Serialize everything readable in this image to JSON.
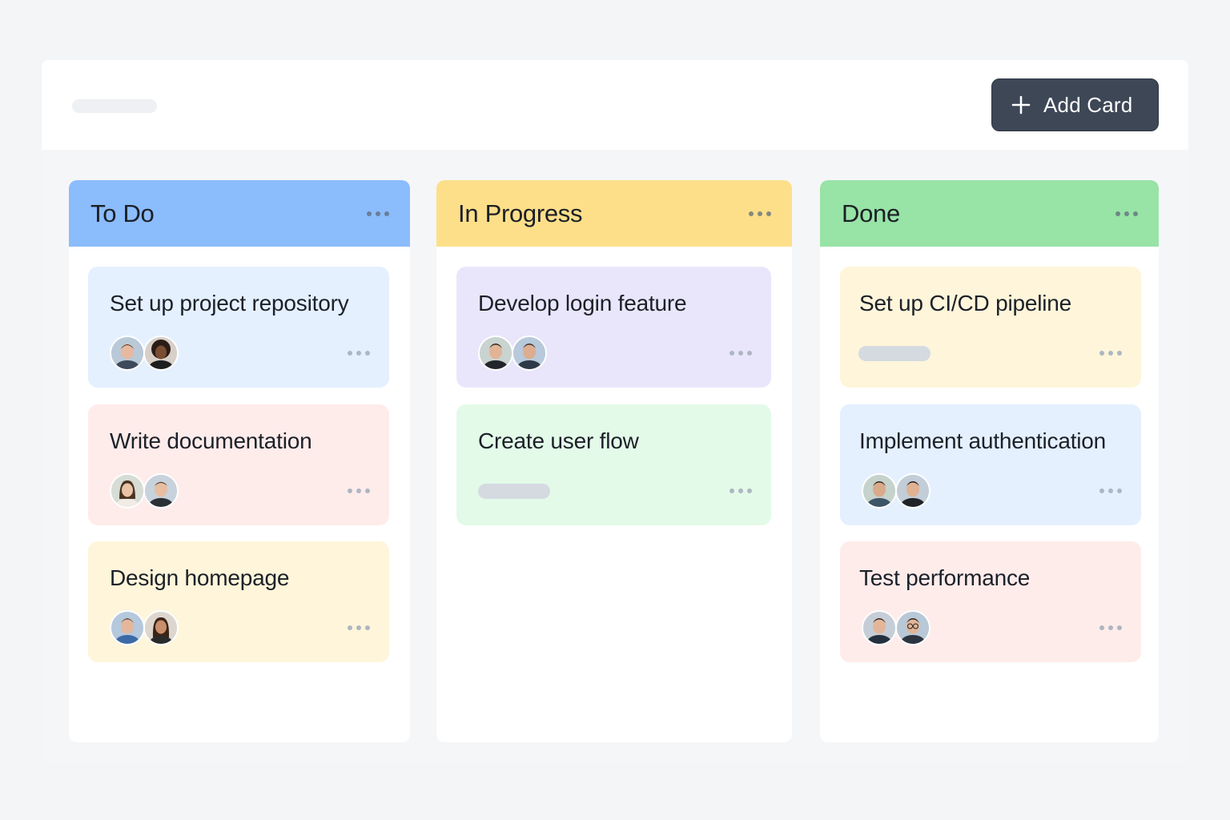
{
  "toolbar": {
    "add_card_label": "Add Card",
    "add_icon": "plus-icon"
  },
  "colors": {
    "todo_header": "#8bbcfc",
    "progress_header": "#fddf8a",
    "done_header": "#98e3a6",
    "card_blue": "#e4f0fe",
    "card_pink": "#feeceb",
    "card_yellow": "#fef5da",
    "card_purple": "#e9e6fb",
    "card_green": "#e3fae9"
  },
  "columns": [
    {
      "title": "To Do",
      "cards": [
        {
          "title": "Set up project repository",
          "avatars": [
            "avatar-man",
            "avatar-woman-curly"
          ]
        },
        {
          "title": "Write documentation",
          "avatars": [
            "avatar-woman",
            "avatar-man"
          ]
        },
        {
          "title": "Design homepage",
          "avatars": [
            "avatar-man",
            "avatar-woman"
          ]
        }
      ]
    },
    {
      "title": "In Progress",
      "cards": [
        {
          "title": "Develop login feature",
          "avatars": [
            "avatar-man",
            "avatar-man"
          ]
        },
        {
          "title": "Create user flow",
          "avatars": []
        }
      ]
    },
    {
      "title": "Done",
      "cards": [
        {
          "title": "Set up CI/CD pipeline",
          "avatars": []
        },
        {
          "title": "Implement authentication",
          "avatars": [
            "avatar-man",
            "avatar-man"
          ]
        },
        {
          "title": "Test performance",
          "avatars": [
            "avatar-man",
            "avatar-man-glasses"
          ]
        }
      ]
    }
  ]
}
